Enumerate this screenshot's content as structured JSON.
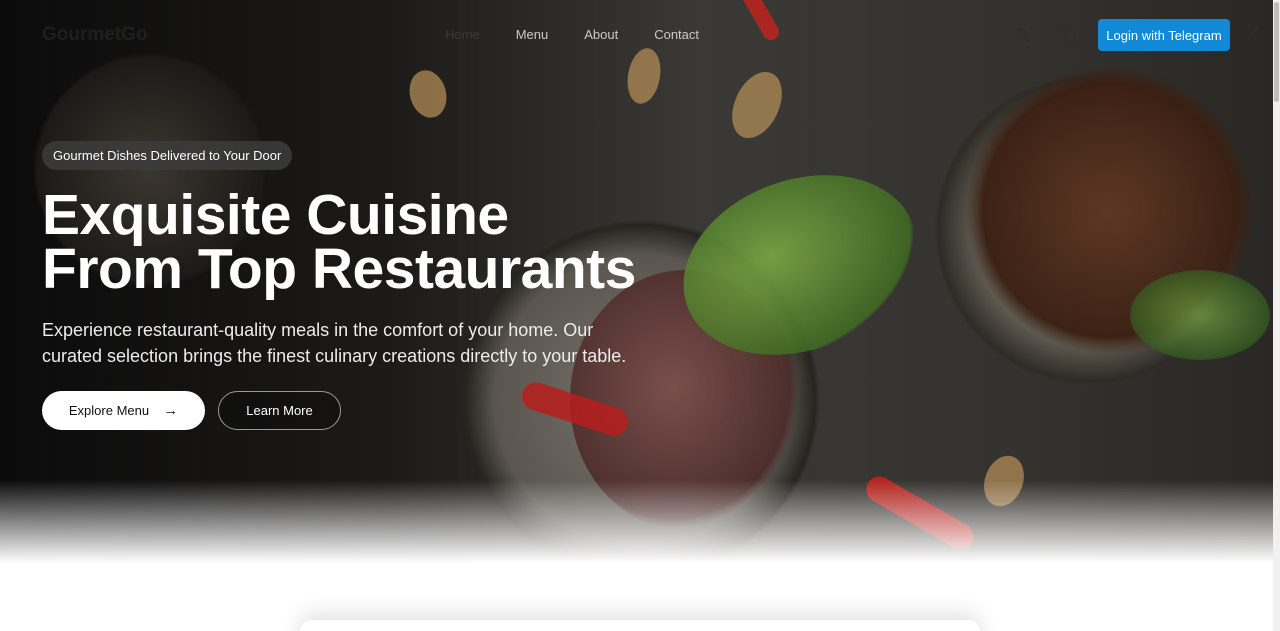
{
  "brand": {
    "logo_text": "GourmetGo"
  },
  "nav": {
    "links": [
      {
        "label": "Home",
        "faded": true
      },
      {
        "label": "Menu",
        "faded": false
      },
      {
        "label": "About",
        "faded": false
      },
      {
        "label": "Contact",
        "faded": false
      }
    ],
    "icons": {
      "search": "search-icon",
      "cart": "cart-icon"
    },
    "login_label": "Login with Telegram",
    "login_color": "#1089d6"
  },
  "hero": {
    "badge": "Gourmet Dishes Delivered to Your Door",
    "headline_line1": "Exquisite Cuisine",
    "headline_line2": "From Top Restaurants",
    "subtitle": "Experience restaurant-quality meals in the comfort of your home. Our curated selection brings the finest culinary creations directly to your table.",
    "primary_button": "Explore Menu",
    "secondary_button": "Learn More"
  }
}
